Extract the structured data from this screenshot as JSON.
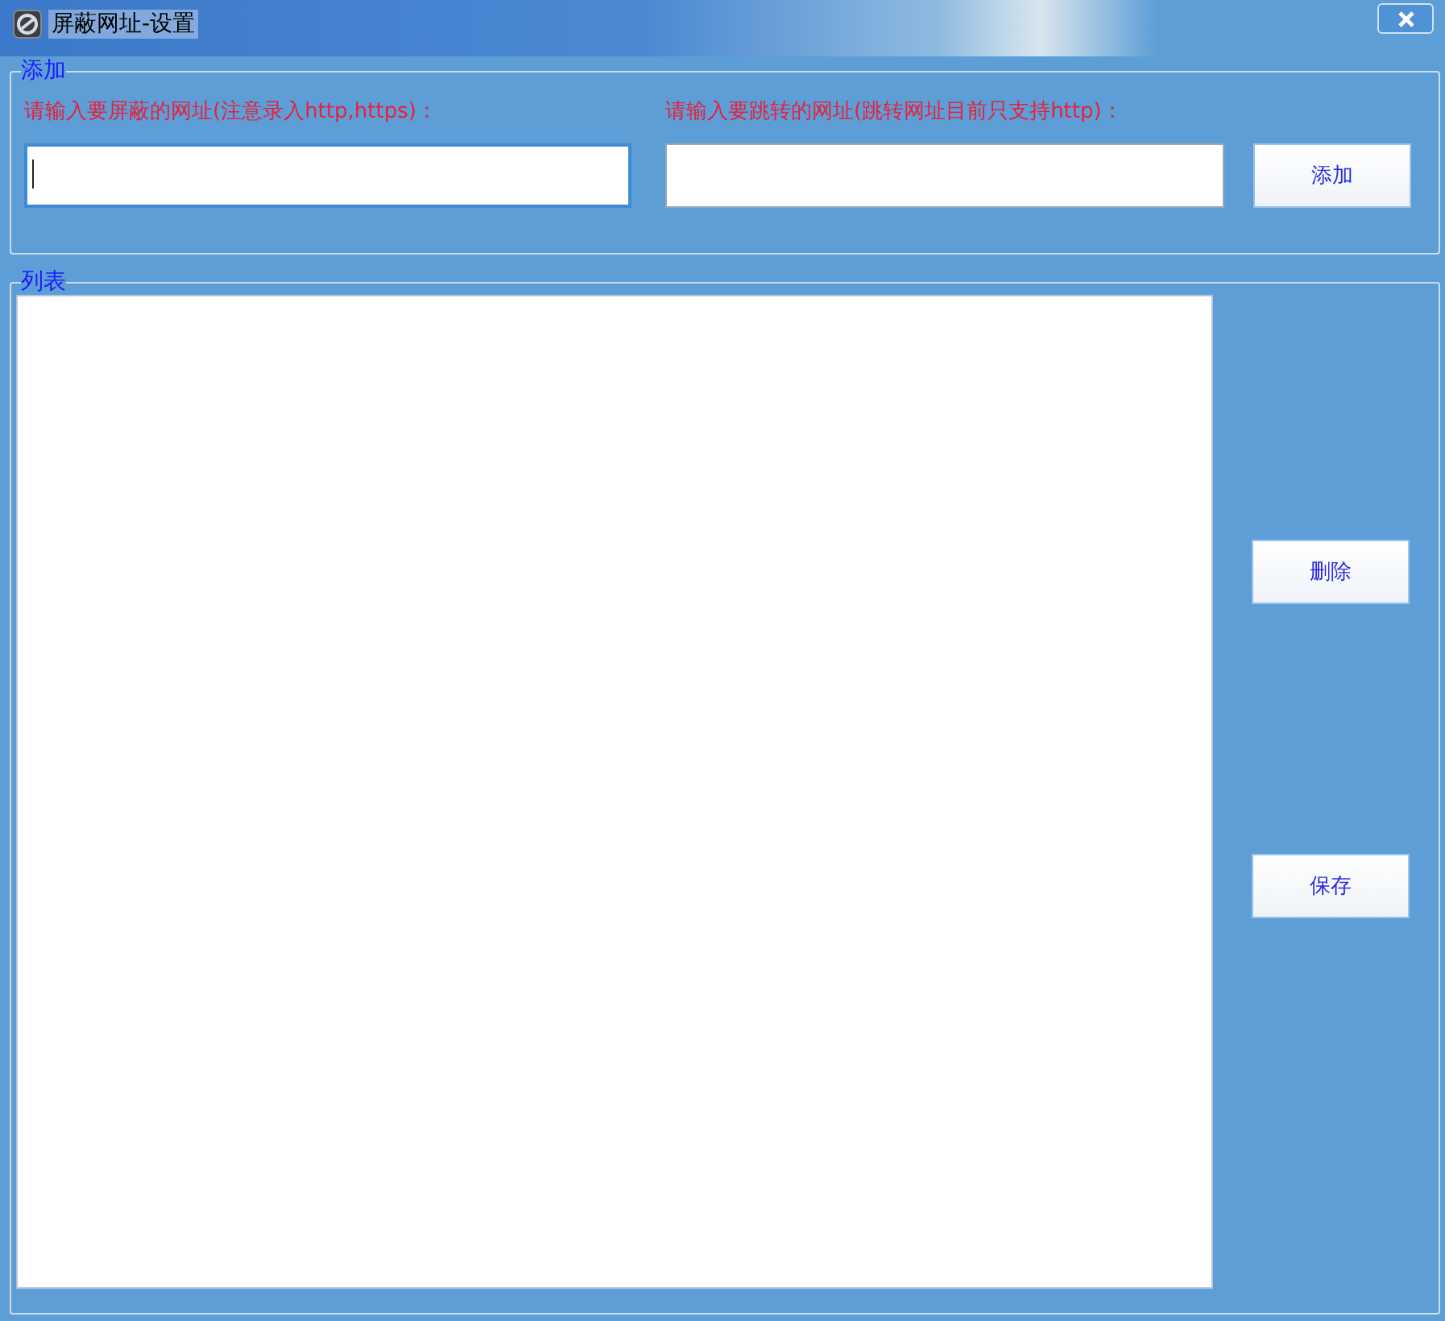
{
  "window": {
    "title": "屏蔽网址-设置"
  },
  "add_group": {
    "title": "添加",
    "fields": [
      {
        "label": "请输入要屏蔽的网址(注意录入http,https)：",
        "focused": true
      },
      {
        "label": "请输入要跳转的网址(跳转网址目前只支持http)：",
        "focused": false
      }
    ],
    "button": "添加"
  },
  "list_group": {
    "title": "列表",
    "buttons": [
      "删除",
      "保存"
    ]
  }
}
